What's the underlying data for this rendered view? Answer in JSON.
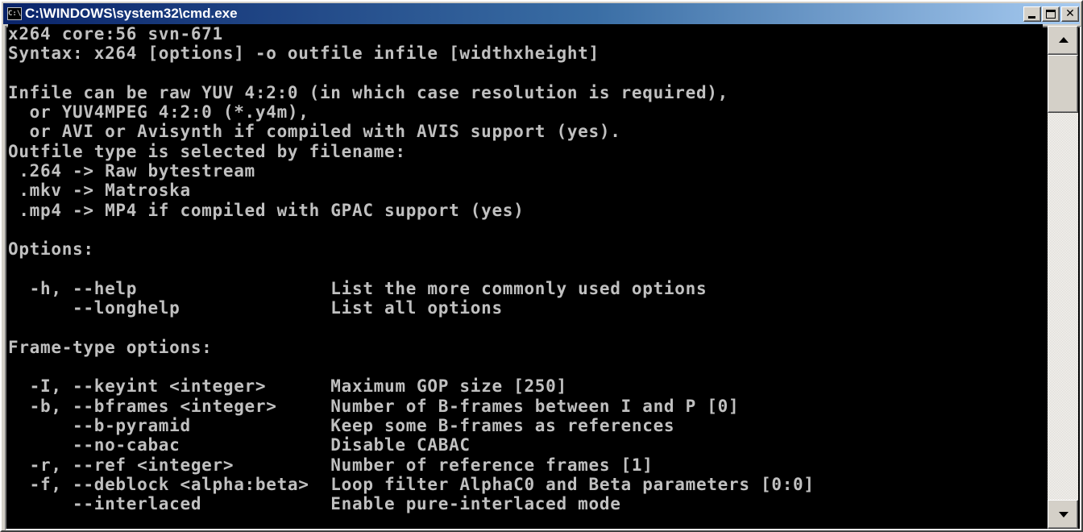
{
  "window": {
    "icon_label": "C:\\",
    "title": "C:\\WINDOWS\\system32\\cmd.exe",
    "controls": {
      "minimize": "minimize-icon",
      "maximize": "maximize-icon",
      "close": "close-icon"
    }
  },
  "console": {
    "lines": [
      "x264 core:56 svn-671",
      "Syntax: x264 [options] -o outfile infile [widthxheight]",
      "",
      "Infile can be raw YUV 4:2:0 (in which case resolution is required),",
      "  or YUV4MPEG 4:2:0 (*.y4m),",
      "  or AVI or Avisynth if compiled with AVIS support (yes).",
      "Outfile type is selected by filename:",
      " .264 -> Raw bytestream",
      " .mkv -> Matroska",
      " .mp4 -> MP4 if compiled with GPAC support (yes)",
      "",
      "Options:",
      "",
      "  -h, --help                  List the more commonly used options",
      "      --longhelp              List all options",
      "",
      "Frame-type options:",
      "",
      "  -I, --keyint <integer>      Maximum GOP size [250]",
      "  -b, --bframes <integer>     Number of B-frames between I and P [0]",
      "      --b-pyramid             Keep some B-frames as references",
      "      --no-cabac              Disable CABAC",
      "  -r, --ref <integer>         Number of reference frames [1]",
      "  -f, --deblock <alpha:beta>  Loop filter AlphaC0 and Beta parameters [0:0]",
      "      --interlaced            Enable pure-interlaced mode"
    ]
  },
  "colors": {
    "title_gradient_start": "#0a246a",
    "title_gradient_end": "#a6caf0",
    "console_background": "#000000",
    "console_text": "#c0c0c0",
    "chrome": "#d4d0c8"
  }
}
